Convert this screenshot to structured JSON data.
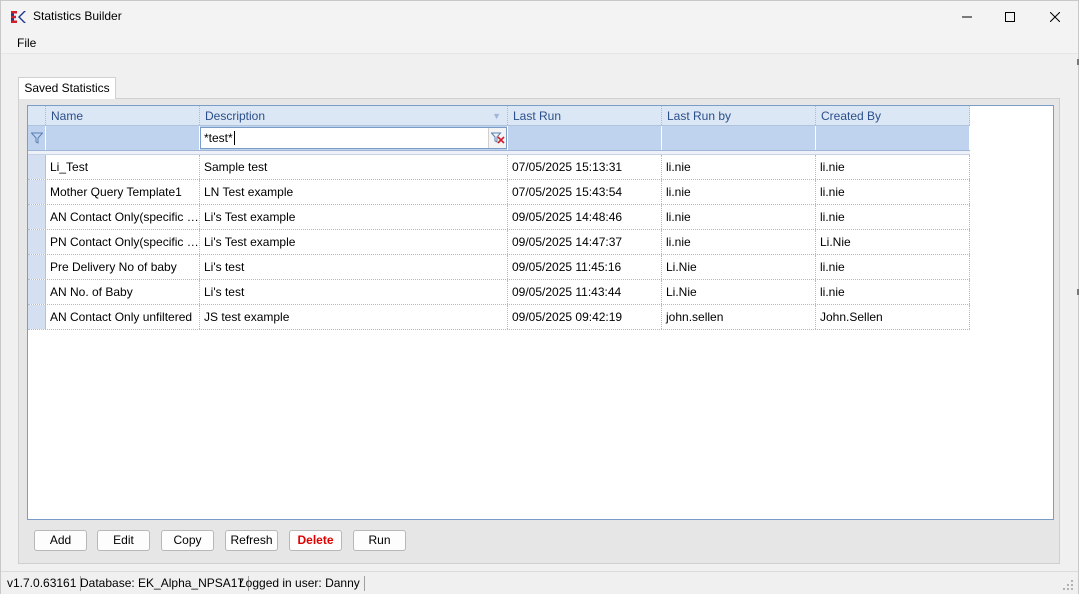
{
  "window": {
    "title": "Statistics Builder",
    "icon": "ek-logo-icon",
    "controls": [
      "minimize-icon",
      "maximize-icon",
      "close-icon"
    ]
  },
  "menu": {
    "file": "File"
  },
  "tab": {
    "label": "Saved Statistics"
  },
  "grid": {
    "columns": [
      "Name",
      "Description",
      "Last Run",
      "Last Run by",
      "Created By"
    ],
    "filter": {
      "description_value": "*test*",
      "filter_icon": "filter-icon",
      "clear_icon": "clear-filter-icon"
    },
    "rows": [
      [
        "Li_Test",
        "Sample test",
        "07/05/2025 15:13:31",
        "li.nie",
        "li.nie"
      ],
      [
        "Mother Query Template1",
        "LN Test example",
        "07/05/2025 15:43:54",
        "li.nie",
        "li.nie"
      ],
      [
        "AN Contact Only(specific da...",
        "Li's Test example",
        "09/05/2025 14:48:46",
        "li.nie",
        "li.nie"
      ],
      [
        "PN Contact Only(specific da...",
        "Li's Test example",
        "09/05/2025 14:47:37",
        "li.nie",
        "Li.Nie"
      ],
      [
        "Pre Delivery No of baby",
        "Li's test",
        "09/05/2025 11:45:16",
        "Li.Nie",
        "li.nie"
      ],
      [
        "AN No. of Baby",
        "Li's test",
        "09/05/2025 11:43:44",
        "Li.Nie",
        "li.nie"
      ],
      [
        "AN Contact Only unfiltered",
        "JS test example",
        "09/05/2025 09:42:19",
        "john.sellen",
        "John.Sellen"
      ]
    ]
  },
  "buttons": {
    "add": "Add",
    "edit": "Edit",
    "copy": "Copy",
    "refresh": "Refresh",
    "delete": "Delete",
    "run": "Run"
  },
  "status": {
    "version": "v1.7.0.63161",
    "database": "Database: EK_Alpha_NPSA17",
    "user": "Logged in user: Danny"
  },
  "colors": {
    "accent": "#7a9cc6",
    "header_text": "#2a4f8a",
    "delete": "#e00000",
    "logo_blue": "#1f3a8a",
    "logo_red": "#d1202f"
  }
}
